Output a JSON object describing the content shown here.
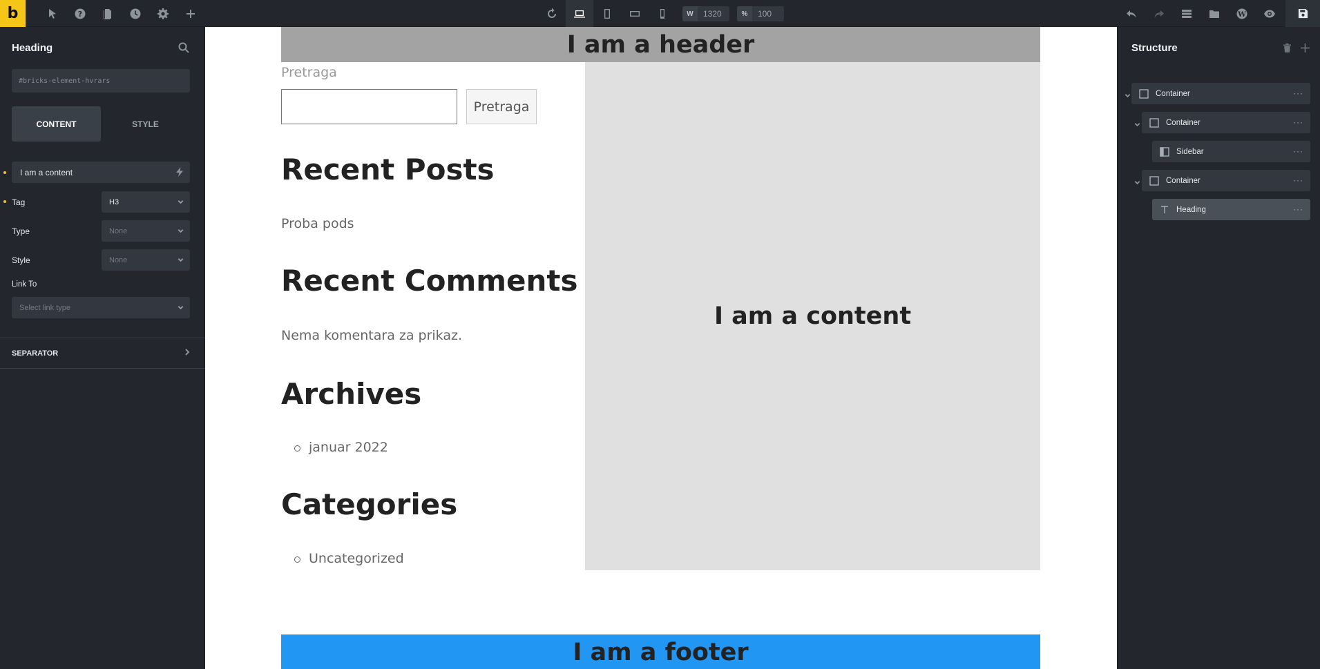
{
  "app": {
    "logo": "b"
  },
  "toolbar": {
    "width_tag": "W",
    "width_value": "1320",
    "zoom_tag": "%",
    "zoom_value": "100"
  },
  "left_panel": {
    "title": "Heading",
    "element_id": "#bricks-element-hvrars",
    "tabs": [
      "CONTENT",
      "STYLE"
    ],
    "content_value": "I am a content",
    "tag_label": "Tag",
    "tag_value": "H3",
    "type_label": "Type",
    "type_value": "None",
    "style_label": "Style",
    "style_value": "None",
    "link_label": "Link To",
    "link_placeholder": "Select link type",
    "separator_label": "SEPARATOR"
  },
  "canvas": {
    "header": "I am a header",
    "search_label": "Pretraga",
    "search_button": "Pretraga",
    "recent_posts_title": "Recent Posts",
    "recent_posts_item": "Proba pods",
    "recent_comments_title": "Recent Comments",
    "recent_comments_text": "Nema komentara za prikaz.",
    "archives_title": "Archives",
    "archives_item": "januar 2022",
    "categories_title": "Categories",
    "categories_item": "Uncategorized",
    "content": "I am a content",
    "footer": "I am a footer"
  },
  "structure": {
    "title": "Structure",
    "nodes": [
      {
        "label": "Container",
        "icon": "container-icon"
      },
      {
        "label": "Container",
        "icon": "container-icon"
      },
      {
        "label": "Sidebar",
        "icon": "sidebar-icon"
      },
      {
        "label": "Container",
        "icon": "container-icon"
      },
      {
        "label": "Heading",
        "icon": "heading-icon"
      }
    ],
    "more": "···"
  },
  "colors": {
    "accent": "#f5c518",
    "panel_bg": "#23272d",
    "header_bg": "#a3a3a3",
    "content_bg": "#e0e0e0",
    "footer_bg": "#2196f3"
  }
}
